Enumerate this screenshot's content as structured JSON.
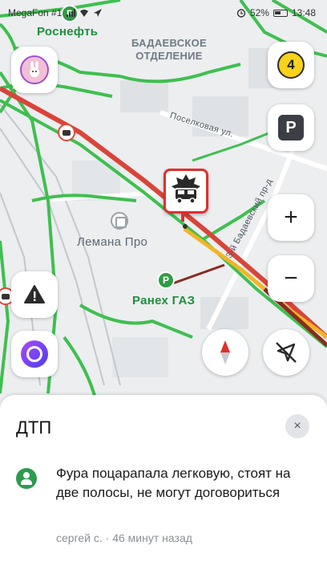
{
  "status_bar": {
    "carrier": "MegaFon #1",
    "battery": "52%",
    "time": "13:48"
  },
  "map": {
    "district_label_line1": "БАДАЕВСКОЕ",
    "district_label_line2": "ОТДЕЛЕНИЕ",
    "street_1": "Поселковая ул.",
    "street_2": "3-й Бадаевский пр-д",
    "poi_lemana": "Лемана Про",
    "poi_raneks": "Ранех ГАЗ",
    "poi_rosneft": "Роснефть",
    "colors": {
      "traffic_green": "#3fbf4f",
      "traffic_red": "#d8453a",
      "traffic_yellow": "#f3b428",
      "traffic_dark": "#8a2b20",
      "incident": "#e0302c",
      "brand_green": "#1e8f3c"
    }
  },
  "controls": {
    "traffic_level": "4",
    "parking_label": "P",
    "zoom_in": "+",
    "zoom_out": "−",
    "profile_icon": "bunny-avatar-icon",
    "report_icon": "warning-triangle-icon",
    "alice_icon": "alice-assistant-icon",
    "compass_icon": "compass-icon",
    "location_icon": "location-off-icon"
  },
  "sheet": {
    "title": "ДТП",
    "close_label": "×",
    "comment": "Фура поцарапала легковую, стоят на две полосы, не могут договориться",
    "author": "сергей с.",
    "separator": " · ",
    "time_ago": "46 минут назад"
  }
}
